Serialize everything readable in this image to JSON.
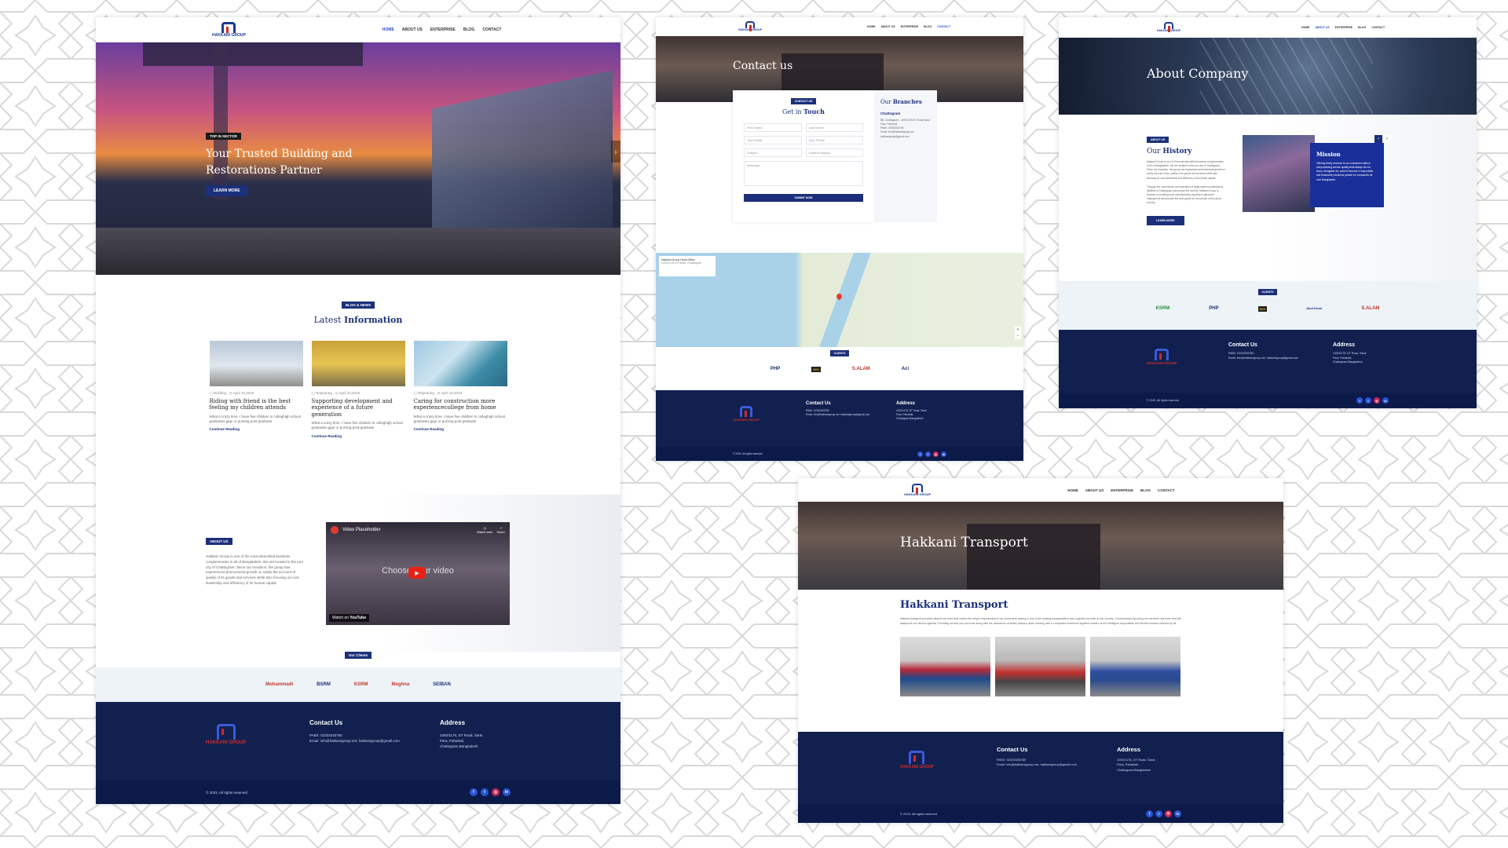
{
  "colors": {
    "accent": "#1b2f7a",
    "footer": "#12204f",
    "brand_red": "#d12b2b",
    "pattern": "#d8d8d8"
  },
  "brand": {
    "logo_text": "HAKKANI GROUP"
  },
  "nav": {
    "home": "HOME",
    "about": "ABOUT US",
    "enterprise": "ENTERPRISE",
    "blog": "BLOG",
    "contact": "CONTACT"
  },
  "home": {
    "hero": {
      "badge": "TOP IN SECTOR",
      "title_line1": "Your Trusted Building and",
      "title_line2": "Restorations Partner",
      "button": "LEARN MORE"
    },
    "blog": {
      "badge": "BLOG & NEWS",
      "title_light": "Latest ",
      "title_bold": "Information",
      "posts": [
        {
          "category": "Building",
          "date": "April 10,2019",
          "title": "Riding with friend is the best feeling my children attends",
          "excerpt": "What a crazy time. I have five children in colleghigh school graduates.jpge or pursing post graduate",
          "link": "Continue Reading"
        },
        {
          "category": "Repearing",
          "date": "April 10,2019",
          "title": "Supporting development and experience of a future generation",
          "excerpt": "What a crazy time. I have five children in colleghigh school graduates.jpge or pursing post graduate",
          "link": "Continue Reading"
        },
        {
          "category": "Repearing",
          "date": "April 10,2019",
          "title": "Caring for construction more experiencecollege from home",
          "excerpt": "What a crazy time. I have five children in colleghigh school graduates.jpge or pursing post graduate",
          "link": "Continue Reading"
        }
      ]
    },
    "about": {
      "badge": "ABOUT US",
      "text": "Hakkani Group is one of the most diversified business conglomerates in all of Bangladesh. We are located in the port city of Chattogram. Since our inception, the group has experienced phenomenal growth on solely the account of quality of its goods and services while also focusing on cost leadership and efficiency of its human capital."
    },
    "video": {
      "title": "Video Placeholder",
      "watch_later": "Watch later",
      "share": "Share",
      "center": "Choose your video",
      "watch_on": "Watch on",
      "youtube": "YouTube"
    },
    "clients_badge": "Our Clients"
  },
  "footer": {
    "contact_title": "Contact Us",
    "pabx": "PABX: 02333333780",
    "email": "Email: info@hakkanigroup.net, hakkanigroup@gmail.com",
    "address_title": "Address",
    "address_lines": [
      "1092/1178, DT Road, Sarai",
      "Para, Pahartali,",
      "Chattogram,Bangladesh"
    ],
    "copyright": "© 2023,",
    "rights": "All rights reserved",
    "socials": [
      "f",
      "t",
      "ig",
      "in"
    ]
  },
  "contact_page": {
    "hero_title": "Contact us",
    "badge": "CONTACT US",
    "form_title_light": "Get in ",
    "form_title_bold": "Touch",
    "fields": [
      "First Name",
      "Last Name",
      "Your Email",
      "Your Phone",
      "Subject",
      "General Inquiry",
      "Message"
    ],
    "submit": "SUBMIT NOW",
    "branches_light": "Our ",
    "branches_bold": "Branches",
    "branch_name": "Chattogram",
    "branch_lines": [
      "BB, Chattogram – 1092/1178,DT Road Sarai",
      "Para, Paharrali",
      "PABX: 02333333780",
      "Email: info@hakkanigroup.net",
      "hakkanigroup@gmail.com"
    ],
    "map_label": "Hakkani Group Head Office",
    "map_sub": "1092/1178 DT Road, Chattogram",
    "clients_badge": "CLIENTS",
    "clients": [
      "PHP",
      "MGI",
      "S.ALAM",
      "Aci"
    ]
  },
  "about_page": {
    "hero_title": "About Company",
    "badge": "ABOUT US",
    "title_light": "Our ",
    "title_bold": "History",
    "text1": "Hakkani Group is one of the most diversified business conglomerates in all of Bangladesh. We are located in the port city of Chattogram. Since our inception, the group has experienced phenomenal growth on solely account of the quality of its goods and services while also focusing on cost leadership and efficiency of its human capital.",
    "text2": "Through the construction and operation of large-scale manufacturing facilities in Chattogram and across the country, Hakkani Group is focused on building local manufacturing capacity to generate employment and provide the best goods for the people of this great country.",
    "button": "LEARN MORE",
    "mission_title": "Mission",
    "mission_text": "Offering timely services to our customers without compromising service quality shall always be our focus. Alongside we, want to become a responsible and trustworthy business partner for companies all over Bangladesh.",
    "clients_badge": "CLIENTS",
    "clients": [
      "KSRM",
      "PHP",
      "MGI",
      "Abul Khair",
      "S.ALAM"
    ]
  },
  "transport_page": {
    "hero_title": "Hakkani Transport",
    "title": "Hakkani Transport",
    "text": "Hakkani transport provides distinct services that meets the unique requirement of our customers making it one of the leading transportation and Logistics provider in the country. Continuously improving our services has been and will always be our utmost agenda. Providing service you can trust along with the assurance of timely delivery while working with a competent workforce together makes us the intelligent responsible and flexible solution desired by all."
  },
  "home_clients": [
    "Mohammadi",
    "BSRM",
    "KSRM",
    "Meghna",
    "SEIBAN"
  ]
}
